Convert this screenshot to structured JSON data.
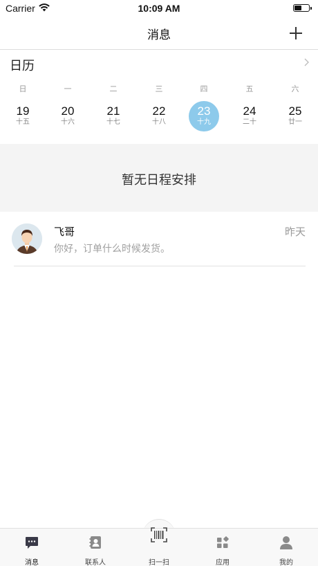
{
  "status_bar": {
    "carrier": "Carrier",
    "time": "10:09 AM"
  },
  "nav": {
    "title": "消息",
    "add_icon": "plus-icon"
  },
  "calendar": {
    "title": "日历",
    "weekdays": [
      "日",
      "一",
      "二",
      "三",
      "四",
      "五",
      "六"
    ],
    "days": [
      {
        "num": "19",
        "lunar": "十五",
        "selected": false
      },
      {
        "num": "20",
        "lunar": "十六",
        "selected": false
      },
      {
        "num": "21",
        "lunar": "十七",
        "selected": false
      },
      {
        "num": "22",
        "lunar": "十八",
        "selected": false
      },
      {
        "num": "23",
        "lunar": "十九",
        "selected": true
      },
      {
        "num": "24",
        "lunar": "二十",
        "selected": false
      },
      {
        "num": "25",
        "lunar": "廿一",
        "selected": false
      }
    ],
    "selected_color": "#8dcaeb"
  },
  "schedule": {
    "empty_text": "暂无日程安排"
  },
  "messages": [
    {
      "name": "飞哥",
      "time": "昨天",
      "preview": "你好，订单什么时候发货。"
    }
  ],
  "tabs": [
    {
      "label": "消息",
      "icon": "chat-bubble-icon",
      "active": true
    },
    {
      "label": "联系人",
      "icon": "contacts-icon",
      "active": false
    },
    {
      "label": "扫一扫",
      "icon": "barcode-scan-icon",
      "active": false
    },
    {
      "label": "应用",
      "icon": "apps-icon",
      "active": false
    },
    {
      "label": "我的",
      "icon": "profile-icon",
      "active": false
    }
  ]
}
